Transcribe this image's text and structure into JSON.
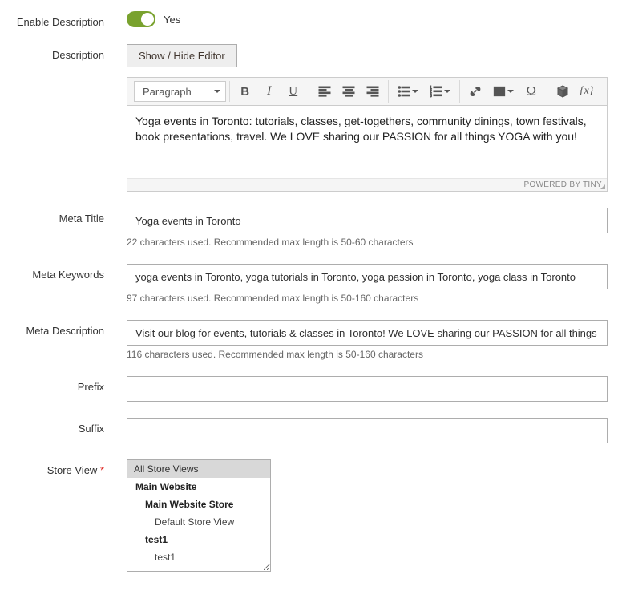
{
  "enable_description": {
    "label": "Enable Description",
    "value_label": "Yes",
    "enabled": true
  },
  "description": {
    "label": "Description",
    "toggle_button": "Show / Hide Editor",
    "format_selector": "Paragraph",
    "content": "Yoga events in Toronto: tutorials, classes, get-togethers, community dinings, town festivals, book presentations, travel. We LOVE sharing our PASSION for all things YOGA with you!",
    "powered_by": "POWERED BY TINY"
  },
  "meta_title": {
    "label": "Meta Title",
    "value": "Yoga events in Toronto",
    "hint": "22 characters used. Recommended max length is 50-60 characters"
  },
  "meta_keywords": {
    "label": "Meta Keywords",
    "value": "yoga events in Toronto, yoga tutorials in Toronto, yoga passion in Toronto, yoga class in Toronto",
    "hint": "97 characters used. Recommended max length is 50-160 characters"
  },
  "meta_description": {
    "label": "Meta Description",
    "value": "Visit our blog for events, tutorials & classes in Toronto! We LOVE sharing our PASSION for all things YOGA with you",
    "hint": "116 characters used. Recommended max length is 50-160 characters"
  },
  "prefix": {
    "label": "Prefix",
    "value": ""
  },
  "suffix": {
    "label": "Suffix",
    "value": ""
  },
  "store_view": {
    "label": "Store View",
    "options": [
      {
        "text": "All Store Views",
        "cls": "ms-item selected",
        "selected": true
      },
      {
        "text": "Main Website",
        "cls": "ms-item bold"
      },
      {
        "text": "Main Website Store",
        "cls": "ms-item indent1"
      },
      {
        "text": "Default Store View",
        "cls": "ms-item indent2"
      },
      {
        "text": "test1",
        "cls": "ms-item indent2b"
      },
      {
        "text": "test1",
        "cls": "ms-item indent2"
      }
    ]
  }
}
